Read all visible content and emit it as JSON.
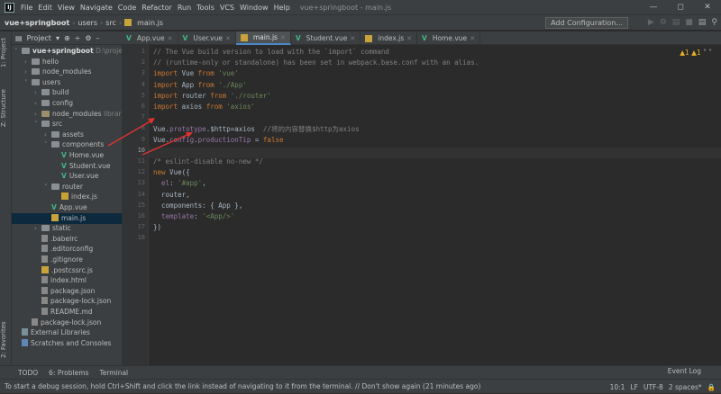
{
  "menu": [
    "File",
    "Edit",
    "View",
    "Navigate",
    "Code",
    "Refactor",
    "Run",
    "Tools",
    "VCS",
    "Window",
    "Help"
  ],
  "window_title": "vue+springboot - main.js",
  "breadcrumb": [
    "vue+springboot",
    "users",
    "src",
    "main.js"
  ],
  "toolbar": {
    "add_config": "Add Configuration..."
  },
  "left_strip": {
    "project": "1: Project",
    "structure": "Z: Structure",
    "favorites": "2: Favorites"
  },
  "project_panel": {
    "title": "Project"
  },
  "tree": [
    {
      "label": "vue+springboot",
      "extra": "D:\\project",
      "depth": 0,
      "kind": "folder",
      "arrow": "v"
    },
    {
      "label": "hello",
      "depth": 1,
      "kind": "folder",
      "arrow": ">"
    },
    {
      "label": "node_modules",
      "depth": 1,
      "kind": "folder",
      "arrow": ">"
    },
    {
      "label": "users",
      "depth": 1,
      "kind": "folder",
      "arrow": "v"
    },
    {
      "label": "build",
      "depth": 2,
      "kind": "folder",
      "arrow": ">"
    },
    {
      "label": "config",
      "depth": 2,
      "kind": "folder",
      "arrow": ">"
    },
    {
      "label": "node_modules",
      "extra": "library",
      "depth": 2,
      "kind": "folderY",
      "arrow": ">"
    },
    {
      "label": "src",
      "depth": 2,
      "kind": "folder",
      "arrow": "v"
    },
    {
      "label": "assets",
      "depth": 3,
      "kind": "folder",
      "arrow": ">"
    },
    {
      "label": "components",
      "depth": 3,
      "kind": "folder",
      "arrow": "v"
    },
    {
      "label": "Home.vue",
      "depth": 4,
      "kind": "vue"
    },
    {
      "label": "Student.vue",
      "depth": 4,
      "kind": "vue"
    },
    {
      "label": "User.vue",
      "depth": 4,
      "kind": "vue"
    },
    {
      "label": "router",
      "depth": 3,
      "kind": "folder",
      "arrow": "v"
    },
    {
      "label": "index.js",
      "depth": 4,
      "kind": "js"
    },
    {
      "label": "App.vue",
      "depth": 3,
      "kind": "vue"
    },
    {
      "label": "main.js",
      "depth": 3,
      "kind": "js",
      "selected": true
    },
    {
      "label": "static",
      "depth": 2,
      "kind": "folder",
      "arrow": ">"
    },
    {
      "label": ".babelrc",
      "depth": 2,
      "kind": "file"
    },
    {
      "label": ".editorconfig",
      "depth": 2,
      "kind": "file"
    },
    {
      "label": ".gitignore",
      "depth": 2,
      "kind": "file"
    },
    {
      "label": ".postcssrc.js",
      "depth": 2,
      "kind": "js"
    },
    {
      "label": "index.html",
      "depth": 2,
      "kind": "file"
    },
    {
      "label": "package.json",
      "depth": 2,
      "kind": "file"
    },
    {
      "label": "package-lock.json",
      "depth": 2,
      "kind": "file"
    },
    {
      "label": "README.md",
      "depth": 2,
      "kind": "file"
    },
    {
      "label": "package-lock.json",
      "depth": 1,
      "kind": "file"
    },
    {
      "label": "External Libraries",
      "depth": 0,
      "kind": "lib"
    },
    {
      "label": "Scratches and Consoles",
      "depth": 0,
      "kind": "scratch"
    }
  ],
  "tabs": [
    {
      "label": "App.vue",
      "kind": "vue"
    },
    {
      "label": "User.vue",
      "kind": "vue"
    },
    {
      "label": "main.js",
      "kind": "js",
      "active": true
    },
    {
      "label": "Student.vue",
      "kind": "vue"
    },
    {
      "label": "index.js",
      "kind": "js"
    },
    {
      "label": "Home.vue",
      "kind": "vue"
    }
  ],
  "editor": {
    "warnings": "▲1 ▲1",
    "current_line": 10,
    "lines": [
      "// The Vue build version to load with the `import` command",
      "// (runtime-only or standalone) has been set in webpack.base.conf with an alias.",
      "import Vue from 'vue'",
      "import App from './App'",
      "import router from './router'",
      "import axios from 'axios'",
      "",
      "Vue.prototype.$http=axios  //将的内容替换$http为axios",
      "Vue.config.productionTip = false",
      "",
      "/* eslint-disable no-new */",
      "new Vue({",
      "  el: '#app',",
      "  router,",
      "  components: { App },",
      "  template: '<App/>'",
      "})",
      ""
    ]
  },
  "bottom_tabs": [
    "TODO",
    "6: Problems",
    "Terminal"
  ],
  "event_log": "Event Log",
  "status": {
    "message": "To start a debug session, hold Ctrl+Shift and click the link instead of navigating to it from the terminal. // Don't show again (21 minutes ago)",
    "position": "10:1",
    "line_sep": "LF",
    "encoding": "UTF-8",
    "indent": "2 spaces*"
  }
}
